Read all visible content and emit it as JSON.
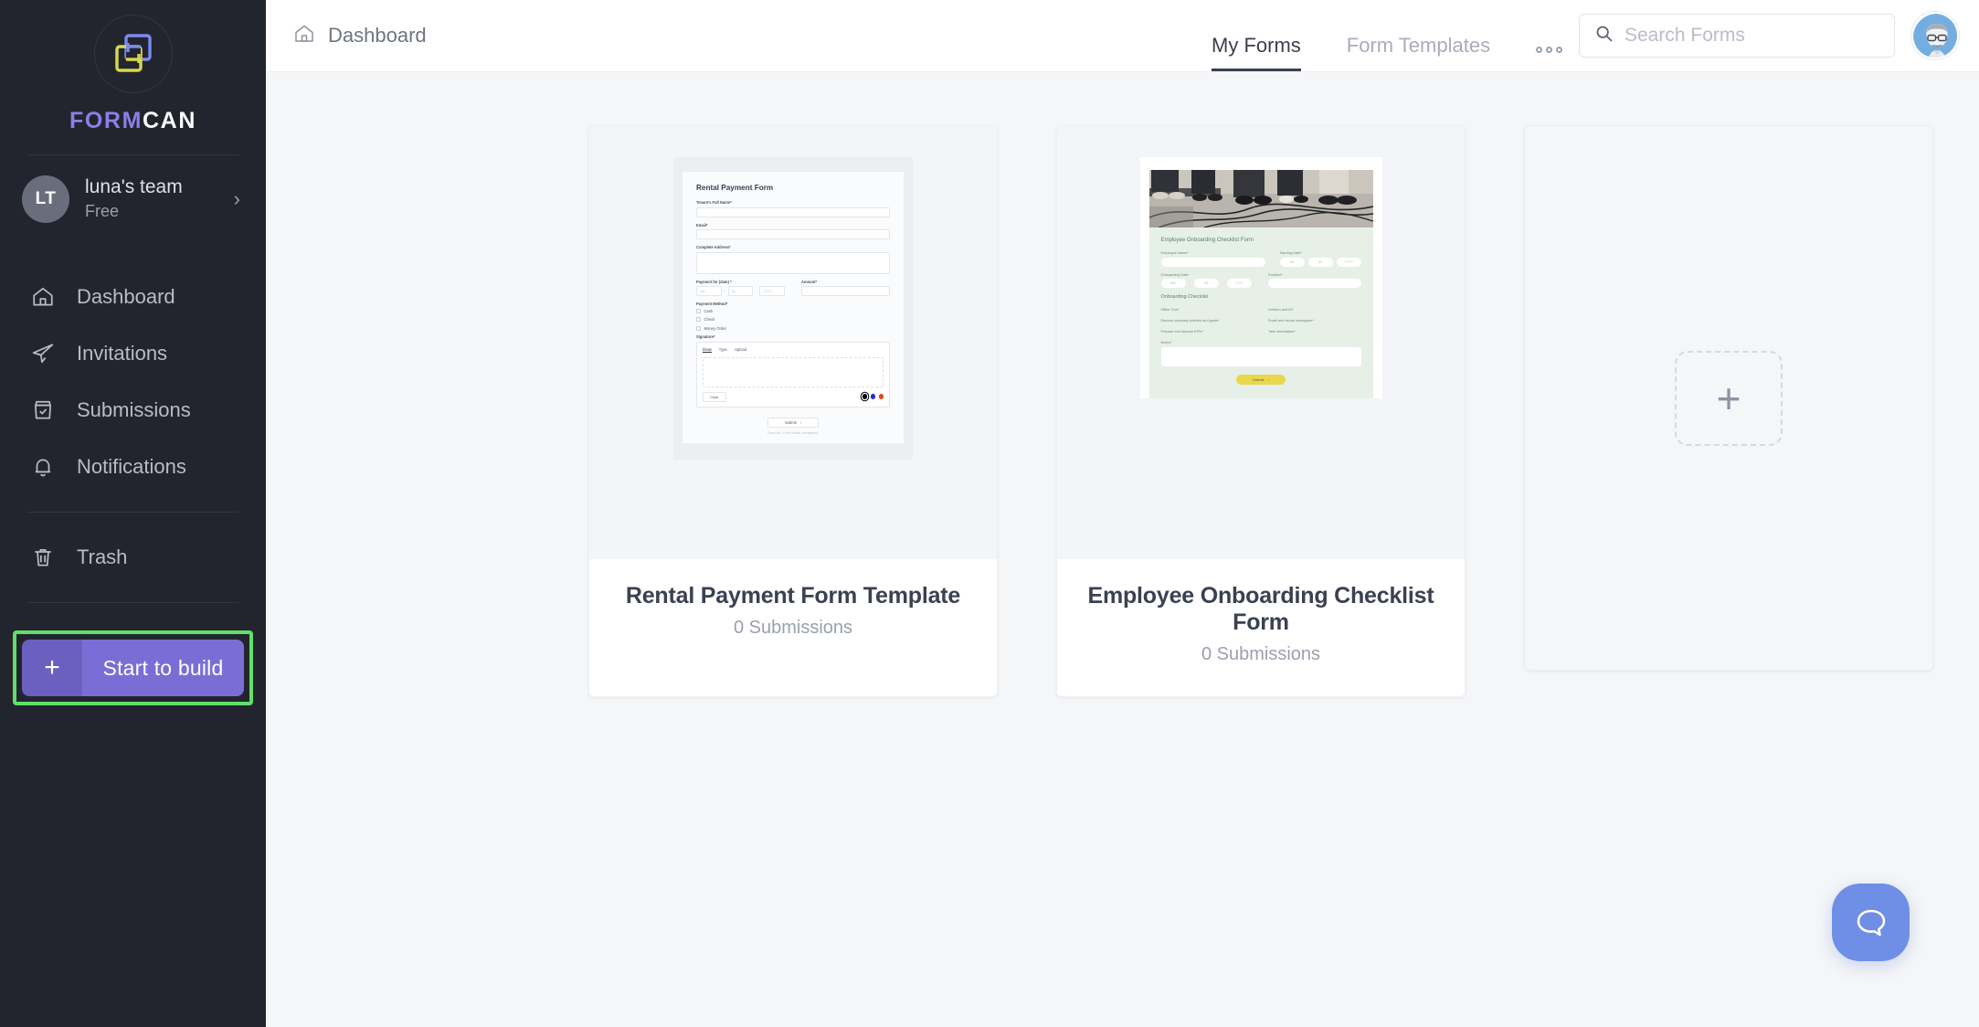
{
  "brand": {
    "word_a": "FORM",
    "word_b": "CAN",
    "logo_icon": "interlocking-squares-logo"
  },
  "team": {
    "initials": "LT",
    "name": "luna's team",
    "plan": "Free",
    "chevron_icon": "chevron-right-icon"
  },
  "sidebar": {
    "items": [
      {
        "label": "Dashboard",
        "icon": "home-icon"
      },
      {
        "label": "Invitations",
        "icon": "paper-plane-icon"
      },
      {
        "label": "Submissions",
        "icon": "inbox-check-icon"
      },
      {
        "label": "Notifications",
        "icon": "bell-icon"
      },
      {
        "label": "Trash",
        "icon": "trash-icon"
      }
    ],
    "build_button": {
      "plus": "+",
      "label": "Start to build",
      "icon": "plus-icon",
      "highlight_color": "#5ee06a",
      "color": "#7a6ed6"
    }
  },
  "topbar": {
    "breadcrumb": {
      "label": "Dashboard",
      "icon": "home-icon"
    },
    "tabs": [
      {
        "label": "My Forms",
        "active": true
      },
      {
        "label": "Form Templates",
        "active": false
      }
    ],
    "more_icon": "three-dots-icon",
    "search": {
      "placeholder": "Search Forms",
      "value": "",
      "icon": "search-icon"
    },
    "avatar": {
      "icon": "user-avatar",
      "bg": "#74aee0"
    }
  },
  "cards": [
    {
      "title": "Rental Payment Form Template",
      "submissions": "0 Submissions",
      "preview": {
        "type": "rental",
        "heading": "Rental Payment Form",
        "fields": [
          {
            "label": "Tenant's Full Name*",
            "kind": "input"
          },
          {
            "label": "Email*",
            "kind": "input"
          },
          {
            "label": "Complete Address*",
            "kind": "textarea"
          }
        ],
        "date_label": "Payment for (date) *",
        "date_parts": [
          "MM",
          "DD",
          "YYYY"
        ],
        "amount_label": "Amount*",
        "method_label": "Payment Method*",
        "methods": [
          "Cash",
          "Check",
          "Money Order"
        ],
        "signature_label": "Signature*",
        "signature_tabs": [
          "Draw",
          "Type",
          "Upload"
        ],
        "clear_label": "Clear",
        "pen_colors": [
          "#000000",
          "#2b2bd6",
          "#e04a18"
        ],
        "submit_label": "Submit",
        "footer": "FormCan - Form builder, reimagined."
      }
    },
    {
      "title": "Employee Onboarding Checklist Form",
      "submissions": "0 Submissions",
      "preview": {
        "type": "onboarding",
        "heading": "Employee Onboarding Checklist Form",
        "employee_label": "Employee Name*",
        "starting_label": "Starting Date*",
        "onboarding_label": "Onboarding Date*",
        "position_label": "Position*",
        "date_parts": [
          "MM",
          "DD",
          "YYYY"
        ],
        "section": "Onboarding Checklist",
        "checklist": [
          "Office Tour*",
          "Uniform and ID*",
          "Discuss company policies and goals*",
          "Email and virtual workspace*",
          "Prepare and discuss KPIs*",
          "Task information*"
        ],
        "notes_label": "Notes*",
        "submit_label": "Submit",
        "submit_color": "#e9d84e"
      }
    },
    {
      "title": "",
      "submissions": "",
      "preview": {
        "type": "empty",
        "plus": "+"
      }
    }
  ],
  "chat": {
    "icon": "chat-bubble-icon",
    "color": "#6f8ee6"
  }
}
